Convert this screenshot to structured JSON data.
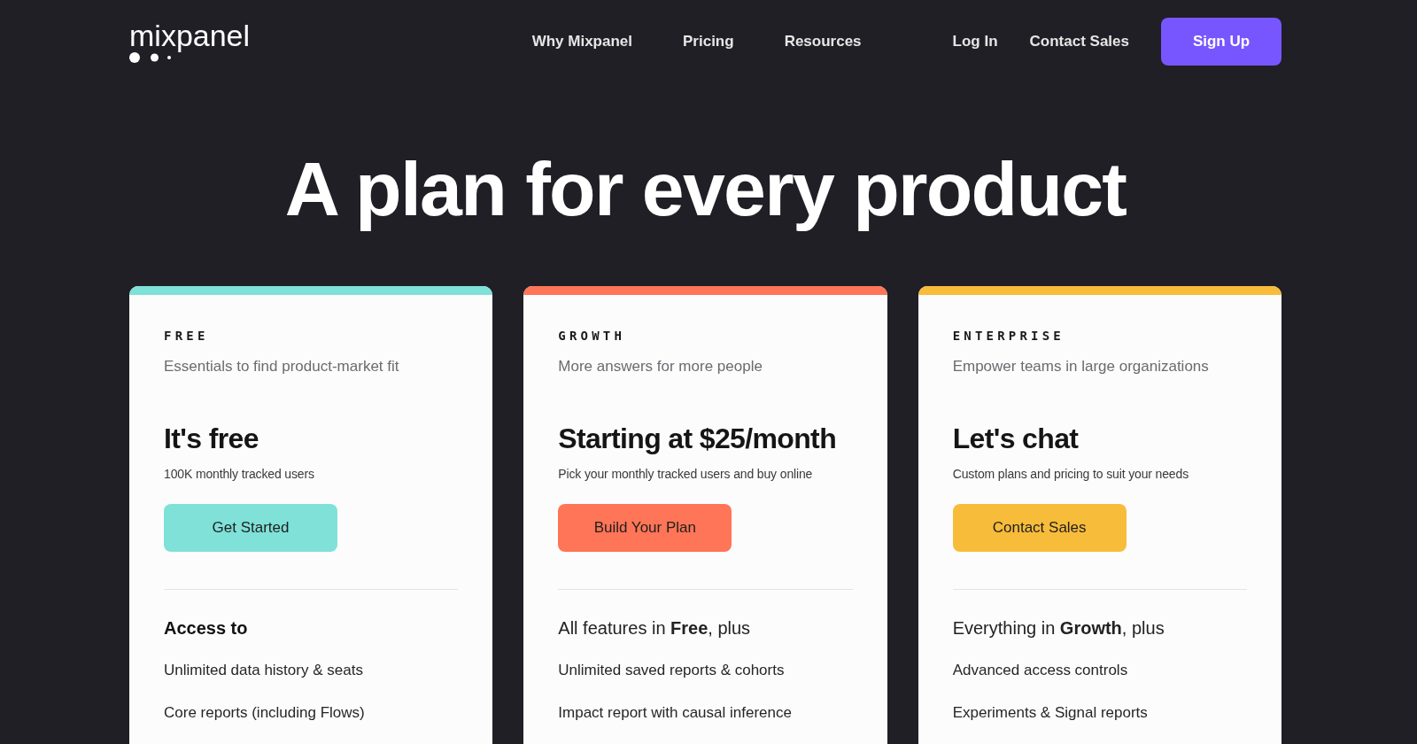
{
  "logo": {
    "wordmark": "mixpanel"
  },
  "nav": {
    "primary": [
      "Why Mixpanel",
      "Pricing",
      "Resources"
    ],
    "secondary": [
      "Log In",
      "Contact Sales"
    ],
    "cta": "Sign Up"
  },
  "headline": "A plan for every product",
  "plans": [
    {
      "name": "FREE",
      "color": "#7fe1d8",
      "tagline": "Essentials to find product-market fit",
      "price": "It's free",
      "price_note": "100K monthly tracked users",
      "button": "Get Started",
      "features_heading": {
        "kind": "title",
        "text": "Access to"
      },
      "features": [
        "Unlimited data history & seats",
        "Core reports (including Flows)"
      ]
    },
    {
      "name": "GROWTH",
      "color": "#ff7557",
      "tagline": "More answers for more people",
      "price": "Starting at $25/month",
      "price_note": "Pick your monthly tracked users and buy online",
      "button": "Build Your Plan",
      "features_heading": {
        "kind": "inherits",
        "text": "All features in **Free**, plus"
      },
      "features": [
        "Unlimited saved reports & cohorts",
        "Impact report with causal inference"
      ]
    },
    {
      "name": "ENTERPRISE",
      "color": "#f8bc3b",
      "tagline": "Empower teams in large organizations",
      "price": "Let's chat",
      "price_note": "Custom plans and pricing to suit your needs",
      "button": "Contact Sales",
      "features_heading": {
        "kind": "inherits",
        "text": "Everything in **Growth**, plus"
      },
      "features": [
        "Advanced access controls",
        "Experiments & Signal reports"
      ]
    }
  ]
}
